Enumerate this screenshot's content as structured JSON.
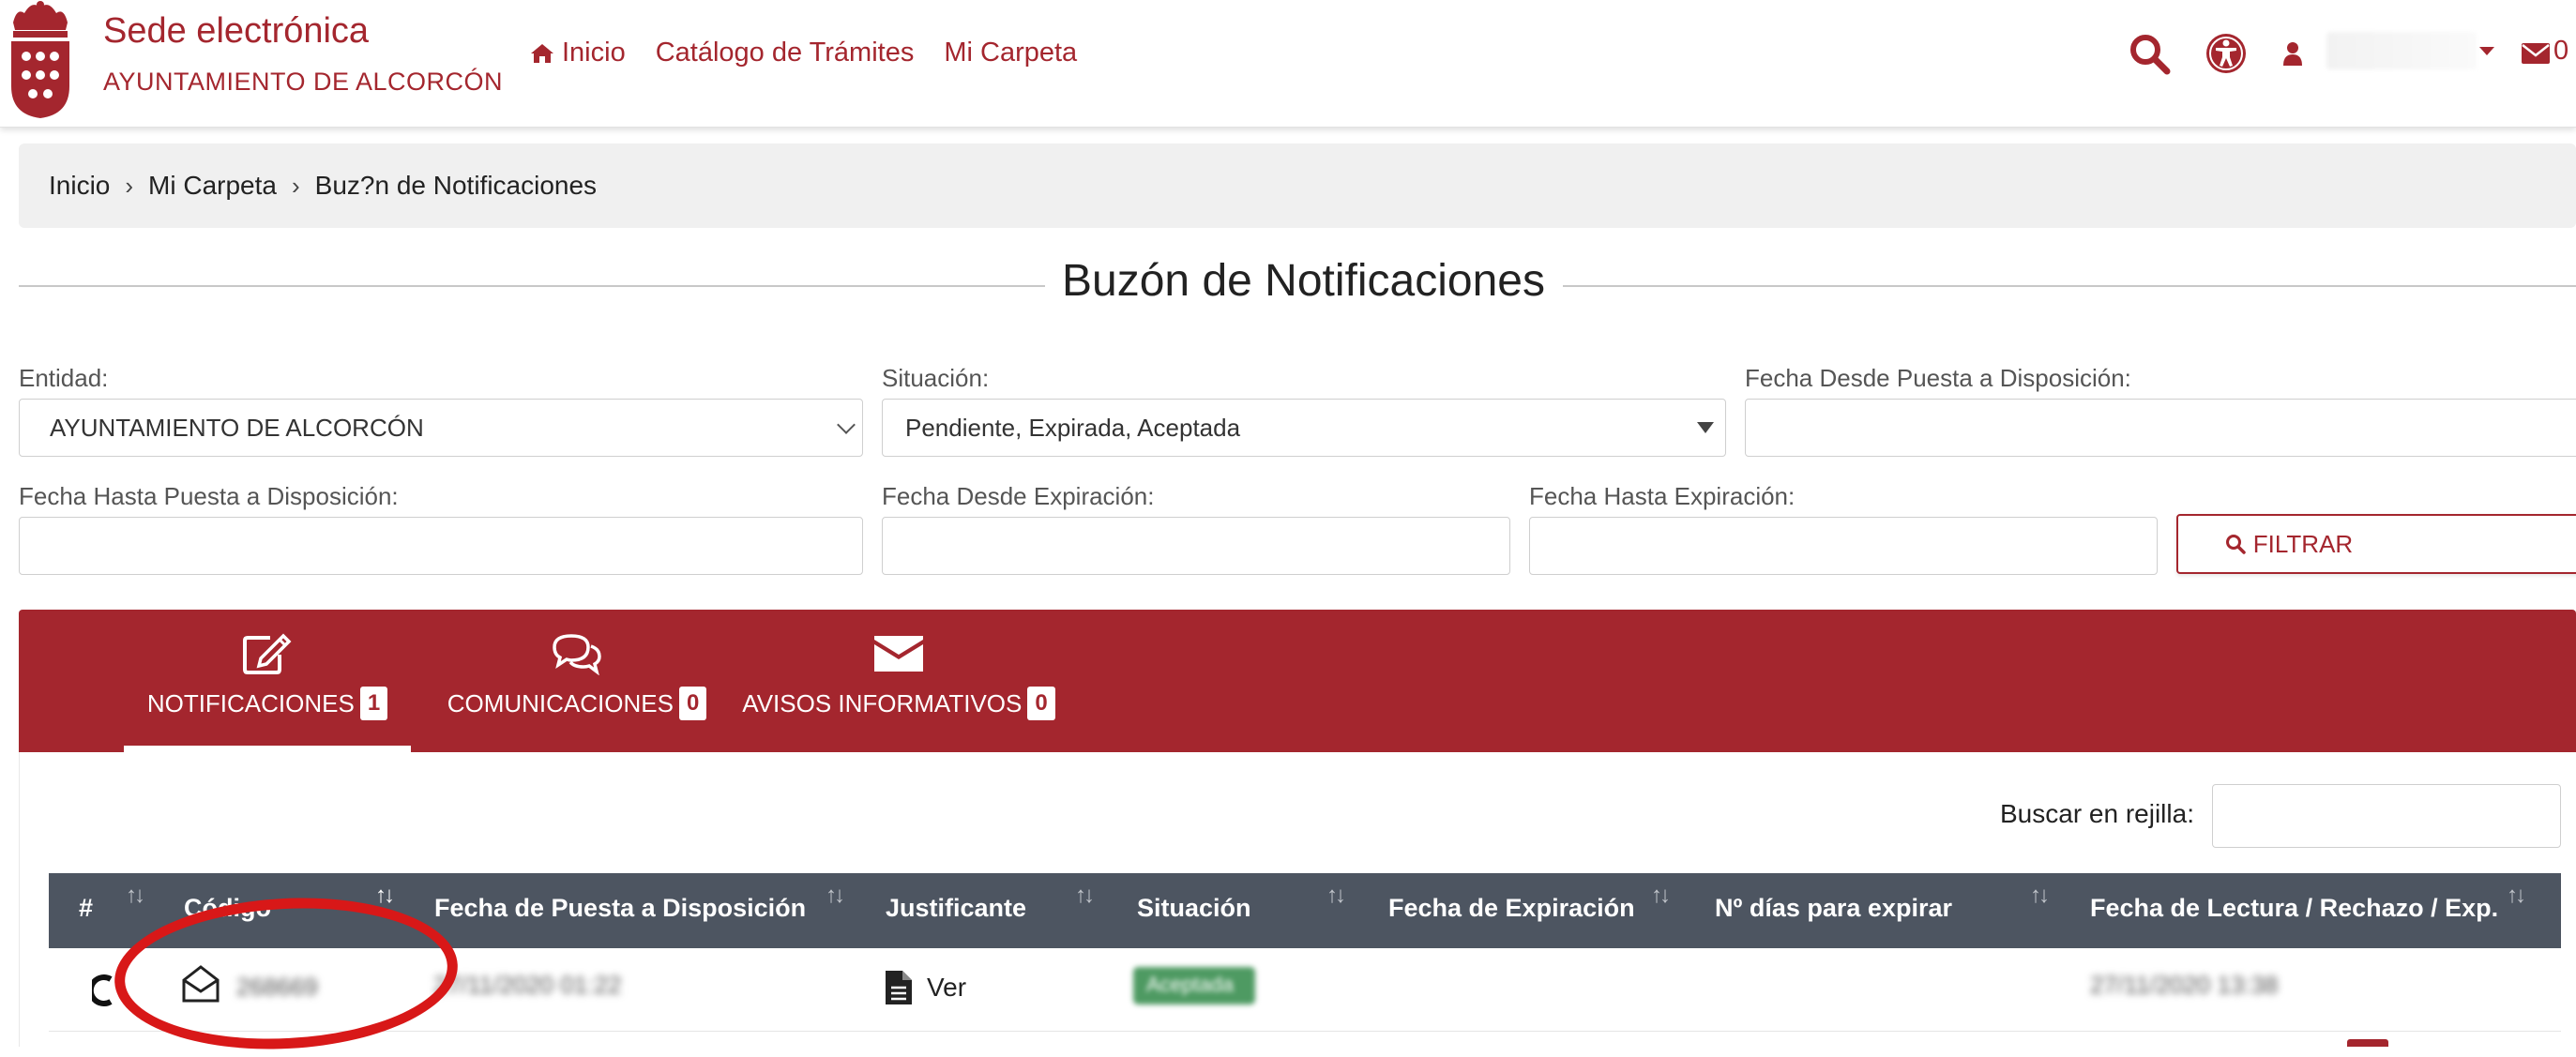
{
  "header": {
    "brand_title": "Sede electrónica",
    "brand_subtitle": "AYUNTAMIENTO DE ALCORCÓN",
    "nav": [
      {
        "label": "Inicio",
        "icon": "home-icon"
      },
      {
        "label": "Catálogo de Trámites"
      },
      {
        "label": "Mi Carpeta"
      }
    ],
    "mail_count": "0"
  },
  "breadcrumb": [
    "Inicio",
    "Mi Carpeta",
    "Buz?n de Notificaciones"
  ],
  "page_title": "Buzón de Notificaciones",
  "filters": {
    "entidad_label": "Entidad:",
    "entidad_value": "AYUNTAMIENTO DE ALCORCÓN",
    "situacion_label": "Situación:",
    "situacion_value": "Pendiente, Expirada, Aceptada",
    "fecha_desde_puesta_label": "Fecha Desde Puesta a Disposición:",
    "fecha_hasta_puesta_label": "Fecha Hasta Puesta a Disposición:",
    "fecha_desde_exp_label": "Fecha Desde Expiración:",
    "fecha_hasta_exp_label": "Fecha Hasta Expiración:",
    "filter_button": "FILTRAR"
  },
  "tabs": [
    {
      "label": "NOTIFICACIONES",
      "count": "1",
      "icon": "edit-icon",
      "active": true
    },
    {
      "label": "COMUNICACIONES",
      "count": "0",
      "icon": "comments-icon",
      "active": false
    },
    {
      "label": "AVISOS INFORMATIVOS",
      "count": "0",
      "icon": "envelope-icon",
      "active": false
    }
  ],
  "grid": {
    "search_label": "Buscar en rejilla:",
    "columns": [
      "#",
      "Código",
      "Fecha de Puesta a Disposición",
      "Justificante",
      "Situación",
      "Fecha de Expiración",
      "Nº días para expirar",
      "Fecha de Lectura / Rechazo / Exp."
    ],
    "rows": [
      {
        "codigo": "268669",
        "fecha_puesta": "27/11/2020 01:22",
        "justificante": "Ver",
        "situacion": "Aceptada",
        "fecha_lectura": "27/11/2020 13:38"
      }
    ]
  },
  "colors": {
    "brand": "#a4262e",
    "table_header": "#4d5561",
    "status_accepted": "#4e9a62"
  }
}
